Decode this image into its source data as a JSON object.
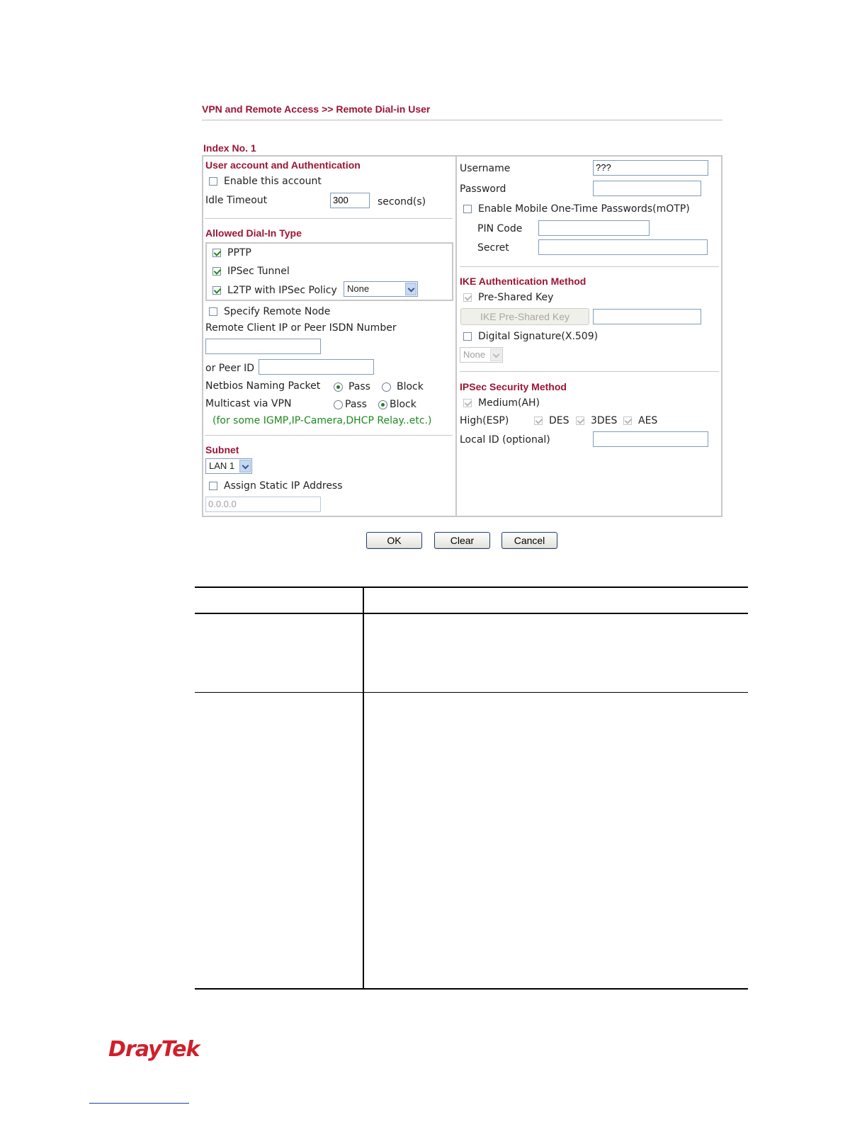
{
  "breadcrumb": "VPN and Remote Access >> Remote Dial-in User",
  "index": "Index No. 1",
  "user_account": {
    "title": "User account and Authentication",
    "enable_label": "Enable this account",
    "idle_timeout_label": "Idle Timeout",
    "idle_timeout_value": "300",
    "idle_timeout_unit": "second(s)"
  },
  "dial_in": {
    "title": "Allowed Dial-In Type",
    "pptp": "PPTP",
    "ipsec": "IPSec Tunnel",
    "l2tp": "L2TP with IPSec Policy",
    "l2tp_policy": "None",
    "specify_remote": "Specify Remote Node",
    "remote_ip_label": "Remote Client IP or Peer ISDN Number",
    "remote_ip_value": "",
    "peer_id_label": "or Peer ID",
    "peer_id_value": "",
    "netbios_label": "Netbios Naming Packet",
    "multicast_label": "Multicast via VPN",
    "pass": "Pass",
    "block": "Block",
    "note": "(for some IGMP,IP-Camera,DHCP Relay..etc.)"
  },
  "subnet": {
    "title": "Subnet",
    "lan": "LAN 1",
    "assign_static": "Assign Static IP Address",
    "static_ip": "0.0.0.0"
  },
  "right": {
    "username_label": "Username",
    "username_value": "???",
    "password_label": "Password",
    "password_value": "",
    "motp_label": "Enable Mobile One-Time Passwords(mOTP)",
    "pin_label": "PIN Code",
    "secret_label": "Secret"
  },
  "ike": {
    "title": "IKE Authentication Method",
    "psk_label": "Pre-Shared Key",
    "psk_button": "IKE Pre-Shared Key",
    "digsig_label": "Digital Signature(X.509)",
    "digsig_select": "None"
  },
  "ipsec_sec": {
    "title": "IPSec Security Method",
    "medium": "Medium(AH)",
    "high": "High(ESP)",
    "des": "DES",
    "tdes": "3DES",
    "aes": "AES",
    "local_id_label": "Local ID (optional)"
  },
  "buttons": {
    "ok": "OK",
    "clear": "Clear",
    "cancel": "Cancel"
  },
  "logo": "DrayTek"
}
